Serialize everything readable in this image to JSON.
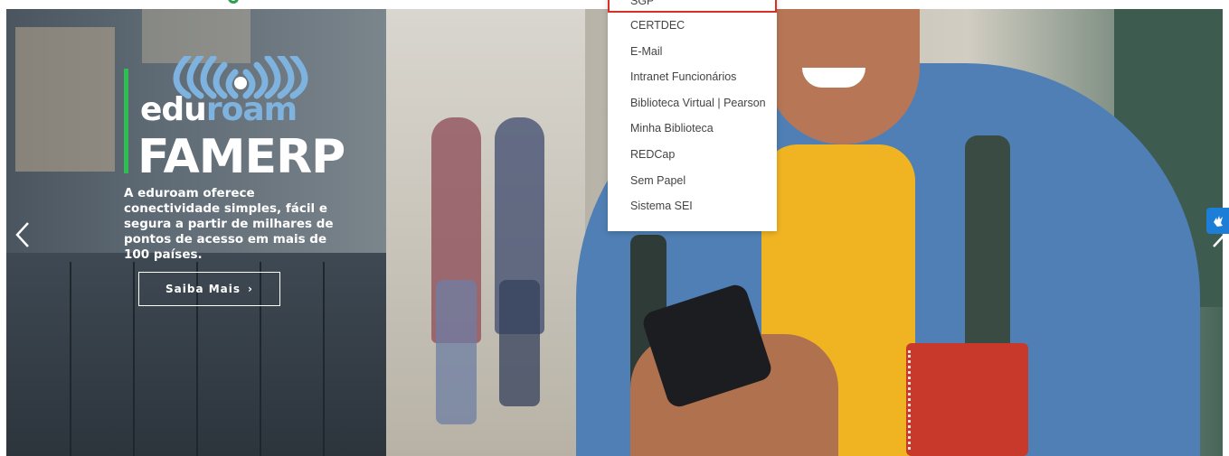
{
  "dropdown": {
    "items": [
      {
        "label": "SGP"
      },
      {
        "label": "CERTDEC"
      },
      {
        "label": "E-Mail"
      },
      {
        "label": "Intranet Funcionários"
      },
      {
        "label": "Biblioteca Virtual | Pearson"
      },
      {
        "label": "Minha Biblioteca"
      },
      {
        "label": "REDCap"
      },
      {
        "label": "Sem Papel"
      },
      {
        "label": "Sistema SEI"
      }
    ],
    "highlighted_index": 0,
    "highlight_color": "#d93025"
  },
  "slide": {
    "logo_text_edu": "edu",
    "logo_text_roam": "roam",
    "title": "FAMERP",
    "tagline": "A eduroam oferece conectividade simples, fácil e segura a partir de milhares de pontos de acesso em mais de 100 países.",
    "button_label": "Saiba Mais",
    "accent_color": "#2ebf52"
  },
  "carousel": {
    "prev_icon": "chevron-left-icon",
    "next_icon": "chevron-right-icon"
  },
  "accessibility": {
    "icon": "sign-language-icon",
    "color": "#1c7ed6"
  }
}
